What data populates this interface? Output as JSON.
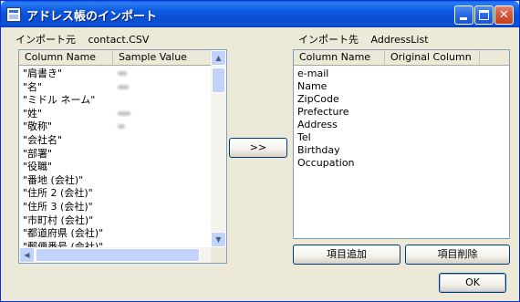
{
  "window": {
    "title": "アドレス帳のインポート"
  },
  "source": {
    "label": "インポート元",
    "file": "contact.CSV",
    "columns": [
      "Column Name",
      "Sample Value"
    ],
    "rows": [
      "\"肩書き\"",
      "\"名\"",
      "\"ミドル ネーム\"",
      "\"姓\"",
      "\"敬称\"",
      "\"会社名\"",
      "\"部署\"",
      "\"役職\"",
      "\"番地 (会社)\"",
      "\"住所 2 (会社)\"",
      "\"住所 3 (会社)\"",
      "\"市町村 (会社)\"",
      "\"都道府県 (会社)\"",
      "\"郵便番号 (会社)\""
    ]
  },
  "target": {
    "label": "インポート先",
    "name": "AddressList",
    "columns": [
      "Column Name",
      "Original Column"
    ],
    "rows": [
      "e-mail",
      "Name",
      "ZipCode",
      "Prefecture",
      "Address",
      "Tel",
      "Birthday",
      "Occupation"
    ]
  },
  "buttons": {
    "transfer": ">>",
    "add": "項目追加",
    "delete": "項目削除",
    "ok": "OK"
  },
  "titlebar": {
    "minimize": "",
    "maximize": "",
    "close": "✕"
  }
}
